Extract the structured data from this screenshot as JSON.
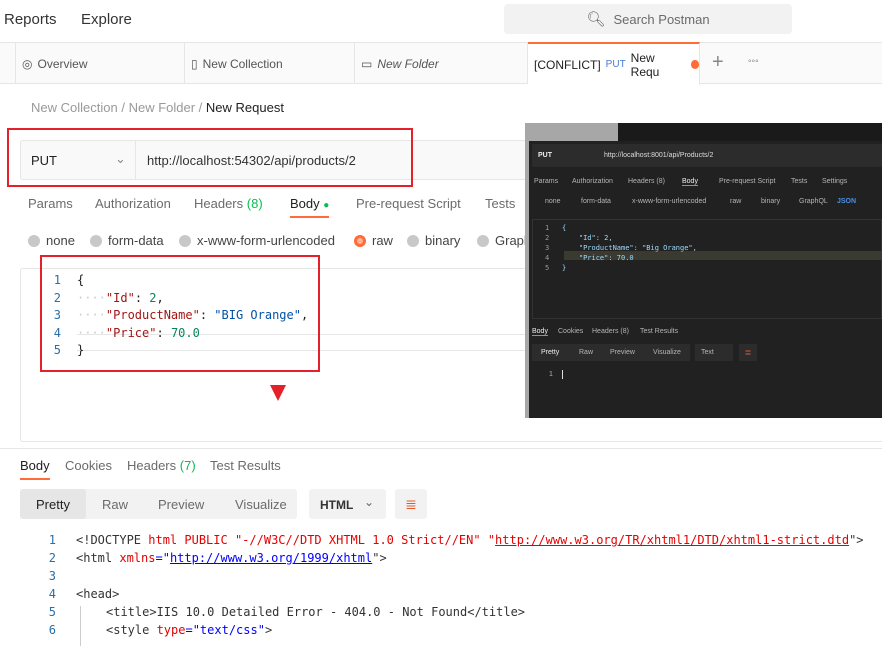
{
  "topbar": {
    "reports": "Reports",
    "explore": "Explore",
    "search_placeholder": "Search Postman"
  },
  "tabs": [
    {
      "label": "Overview",
      "icon": "overview-icon"
    },
    {
      "label": "New Collection",
      "icon": "collection-icon"
    },
    {
      "label": "New Folder",
      "icon": "folder-icon"
    },
    {
      "prefix": "[CONFLICT]",
      "method": "PUT",
      "label": "New Requ",
      "active": true
    }
  ],
  "breadcrumb": {
    "collection": "New Collection",
    "folder": "New Folder",
    "request": "New Request",
    "sep": "/"
  },
  "request": {
    "method": "PUT",
    "url": "http://localhost:54302/api/products/2"
  },
  "request_tabs": {
    "params": "Params",
    "authorization": "Authorization",
    "headers": "Headers",
    "headers_count": "(8)",
    "body": "Body",
    "prerequest": "Pre-request Script",
    "tests": "Tests"
  },
  "body_types": {
    "none": "none",
    "formdata": "form-data",
    "urlencoded": "x-www-form-urlencoded",
    "raw": "raw",
    "binary": "binary",
    "graphql": "Graph",
    "selected": "raw"
  },
  "body_lines": [
    "{",
    "    \"Id\": 2,",
    "    \"ProductName\": \"BIG Orange\",",
    "    \"Price\": 70.0",
    "}"
  ],
  "body_parts": {
    "l1": "{",
    "k2": "\"Id\"",
    "v2": "2",
    "k3": "\"ProductName\"",
    "v3": "\"BIG Orange\"",
    "k4": "\"Price\"",
    "v4": "70.0",
    "l5": "}",
    "dots": "····"
  },
  "response_tabs": {
    "body": "Body",
    "cookies": "Cookies",
    "headers": "Headers",
    "headers_count": "(7)",
    "tests": "Test Results"
  },
  "response_view": {
    "pretty": "Pretty",
    "raw": "Raw",
    "preview": "Preview",
    "visualize": "Visualize",
    "format": "HTML"
  },
  "response_lines": {
    "l1a": "<!DOCTYPE",
    "l1b": " html PUBLIC ",
    "l1c": "\"-//W3C//DTD XHTML 1.0 Strict//EN\"",
    "l1d": " \"",
    "l1e": "http://www.w3.org/TR/xhtml1/DTD/xhtml1-strict.dtd",
    "l1f": "\">",
    "l2a": "<html ",
    "l2b": "xmlns",
    "l2c": "=\"",
    "l2d": "http://www.w3.org/1999/xhtml",
    "l2e": "\">",
    "l4": "<head>",
    "l5": "<title>IIS 10.0 Detailed Error - 404.0 - Not Found</title>",
    "l6a": "<style ",
    "l6b": "type",
    "l6c": "=\"text/css\"",
    "l6d": ">"
  },
  "inset": {
    "method": "PUT",
    "url": "http://localhost:8001/api/Products/2",
    "tabs": [
      "Params",
      "Authorization",
      "Headers (8)",
      "Body",
      "Pre-request Script",
      "Tests",
      "Settings"
    ],
    "radios": [
      "none",
      "form-data",
      "x-www-form-urlencoded",
      "raw",
      "binary",
      "GraphQL"
    ],
    "format": "JSON",
    "lines": [
      "{",
      "    \"Id\": 2,",
      "    \"ProductName\": \"Big Orange\",",
      "    \"Price\": 70.0",
      "}"
    ],
    "resp_tabs": [
      "Body",
      "Cookies",
      "Headers (8)",
      "Test Results"
    ],
    "resp_view": [
      "Pretty",
      "Raw",
      "Preview",
      "Visualize"
    ],
    "resp_format": "Text",
    "resp_line": "1"
  },
  "colors": {
    "accent": "#ff6c37",
    "annotation": "#e4202a",
    "count": "#0cbb52"
  }
}
